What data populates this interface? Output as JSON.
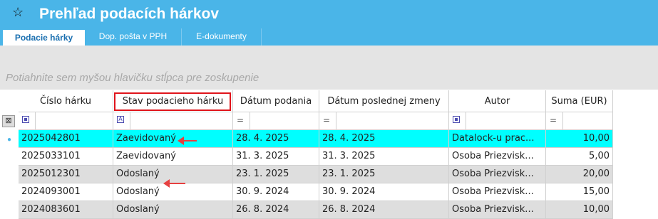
{
  "window": {
    "title": "Prehľad podacích hárkov"
  },
  "tabs": [
    {
      "label": "Podacie hárky",
      "active": true
    },
    {
      "label": "Dop. pošta v PPH",
      "active": false
    },
    {
      "label": "E-dokumenty",
      "active": false
    }
  ],
  "grouping": {
    "hint": "Potiahnite sem myšou hlavičku stĺpca pre zoskupenie"
  },
  "table": {
    "columns": [
      "Číslo hárku",
      "Stav podacieho hárku",
      "Dátum podania",
      "Dátum poslednej zmeny",
      "Autor",
      "Suma (EUR)"
    ],
    "filters": [
      "▣",
      "A",
      "=",
      "=",
      "▣",
      "="
    ],
    "rows": [
      [
        "2025042801",
        "Zaevidovaný",
        "28. 4. 2025",
        "28. 4. 2025",
        "Datalock-u prac...",
        "10,00"
      ],
      [
        "2025033101",
        "Zaevidovaný",
        "31. 3. 2025",
        "31. 3. 2025",
        "Osoba  Priezvisk...",
        "5,00"
      ],
      [
        "2025012301",
        "Odoslaný",
        "23. 1. 2025",
        "23. 1. 2025",
        "Osoba  Priezvisk...",
        "20,00"
      ],
      [
        "2024093001",
        "Odoslaný",
        "30. 9. 2024",
        "30. 9. 2024",
        "Osoba  Priezvisk...",
        "15,00"
      ],
      [
        "2024083601",
        "Odoslaný",
        "26. 8. 2024",
        "26. 8. 2024",
        "Osoba  Priezvisk...",
        "10,00"
      ]
    ]
  },
  "colors": {
    "accent": "#4ab5e8",
    "highlight_row": "#00ffff",
    "annotation_red": "#e0141b"
  }
}
